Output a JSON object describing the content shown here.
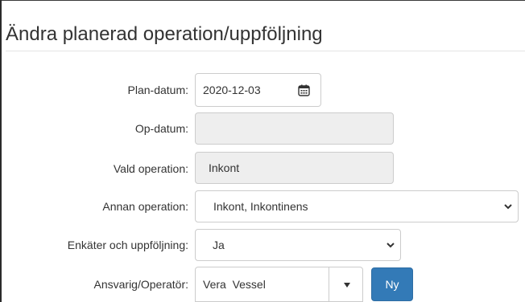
{
  "form": {
    "title": "Ändra planerad operation/uppföljning",
    "plan_datum": {
      "label": "Plan-datum:",
      "value": "2020-12-03"
    },
    "op_datum": {
      "label": "Op-datum:",
      "value": ""
    },
    "vald_operation": {
      "label": "Vald operation:",
      "value": "Inkont"
    },
    "annan_operation": {
      "label": "Annan operation:",
      "value": "Inkont, Inkontinens"
    },
    "enkater": {
      "label": "Enkäter och uppföljning:",
      "value": "Ja"
    },
    "ansvarig": {
      "label": "Ansvarig/Operatör:",
      "value": "Vera  Vessel"
    },
    "ny_button": "Ny"
  },
  "icons": [
    "calendar-icon",
    "chevron-down-icon",
    "caret-down-icon"
  ],
  "colors": {
    "primary": "#337ab7",
    "readonly_bg": "#eeeeee",
    "border": "#cccccc",
    "text": "#333333"
  }
}
